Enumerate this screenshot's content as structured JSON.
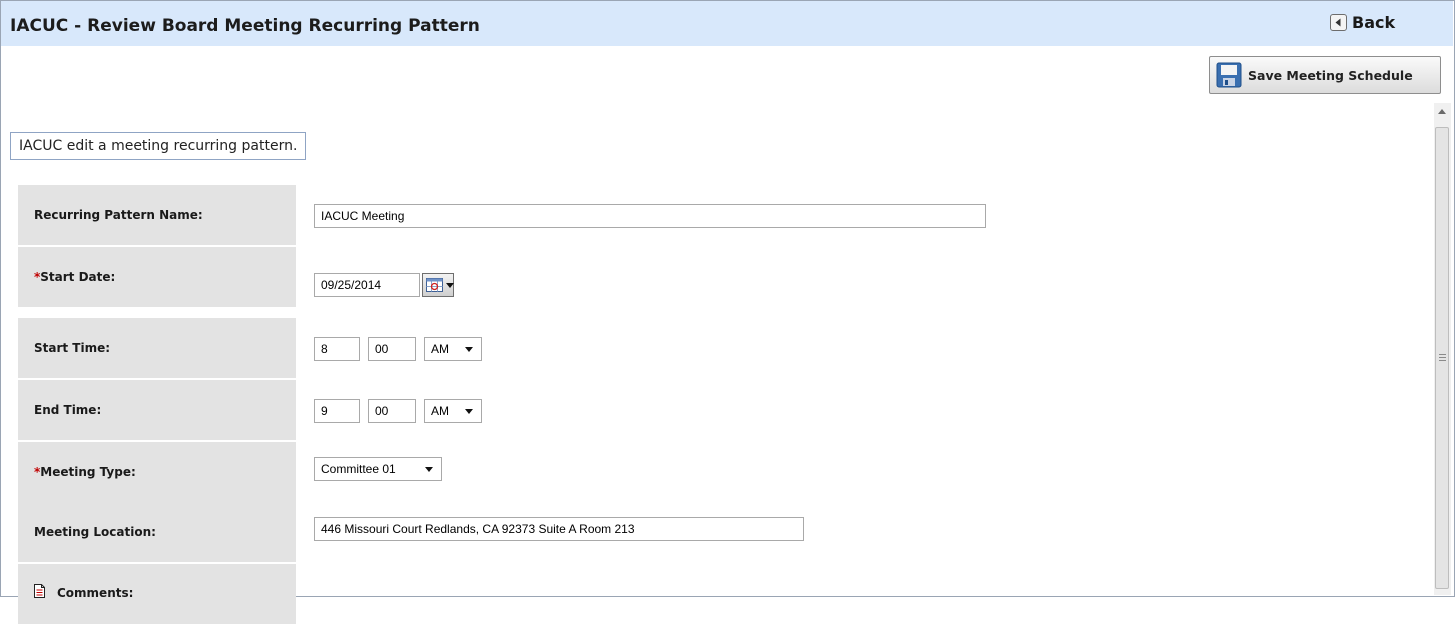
{
  "header": {
    "title": "IACUC - Review Board Meeting Recurring Pattern",
    "back_label": "Back"
  },
  "toolbar": {
    "save_label": "Save Meeting Schedule"
  },
  "instructions": "IACUC edit a meeting recurring pattern.",
  "form": {
    "pattern_name": {
      "label": "Recurring Pattern Name:",
      "value": "IACUC Meeting"
    },
    "start_date": {
      "required_mark": "*",
      "label": "Start Date:",
      "value": "09/25/2014"
    },
    "start_time": {
      "label": "Start Time:",
      "hour": "8",
      "minute": "00",
      "ampm": "AM"
    },
    "end_time": {
      "label": "End Time:",
      "hour": "9",
      "minute": "00",
      "ampm": "AM"
    },
    "meeting_type": {
      "required_mark": "*",
      "label": "Meeting Type:",
      "value": "Committee 01"
    },
    "meeting_location": {
      "label": "Meeting Location:",
      "value": "446 Missouri Court Redlands, CA 92373 Suite A Room 213"
    },
    "comments": {
      "label": "Comments:"
    }
  },
  "colors": {
    "header_bg": "#d8e8fb",
    "label_bg": "#e3e3e3",
    "required": "#c00000",
    "save_icon_blue": "#3a6fb0"
  },
  "icons": {
    "back": "arrow-left-icon",
    "save": "floppy-disk-icon",
    "calendar": "calendar-icon",
    "comments": "document-icon"
  }
}
